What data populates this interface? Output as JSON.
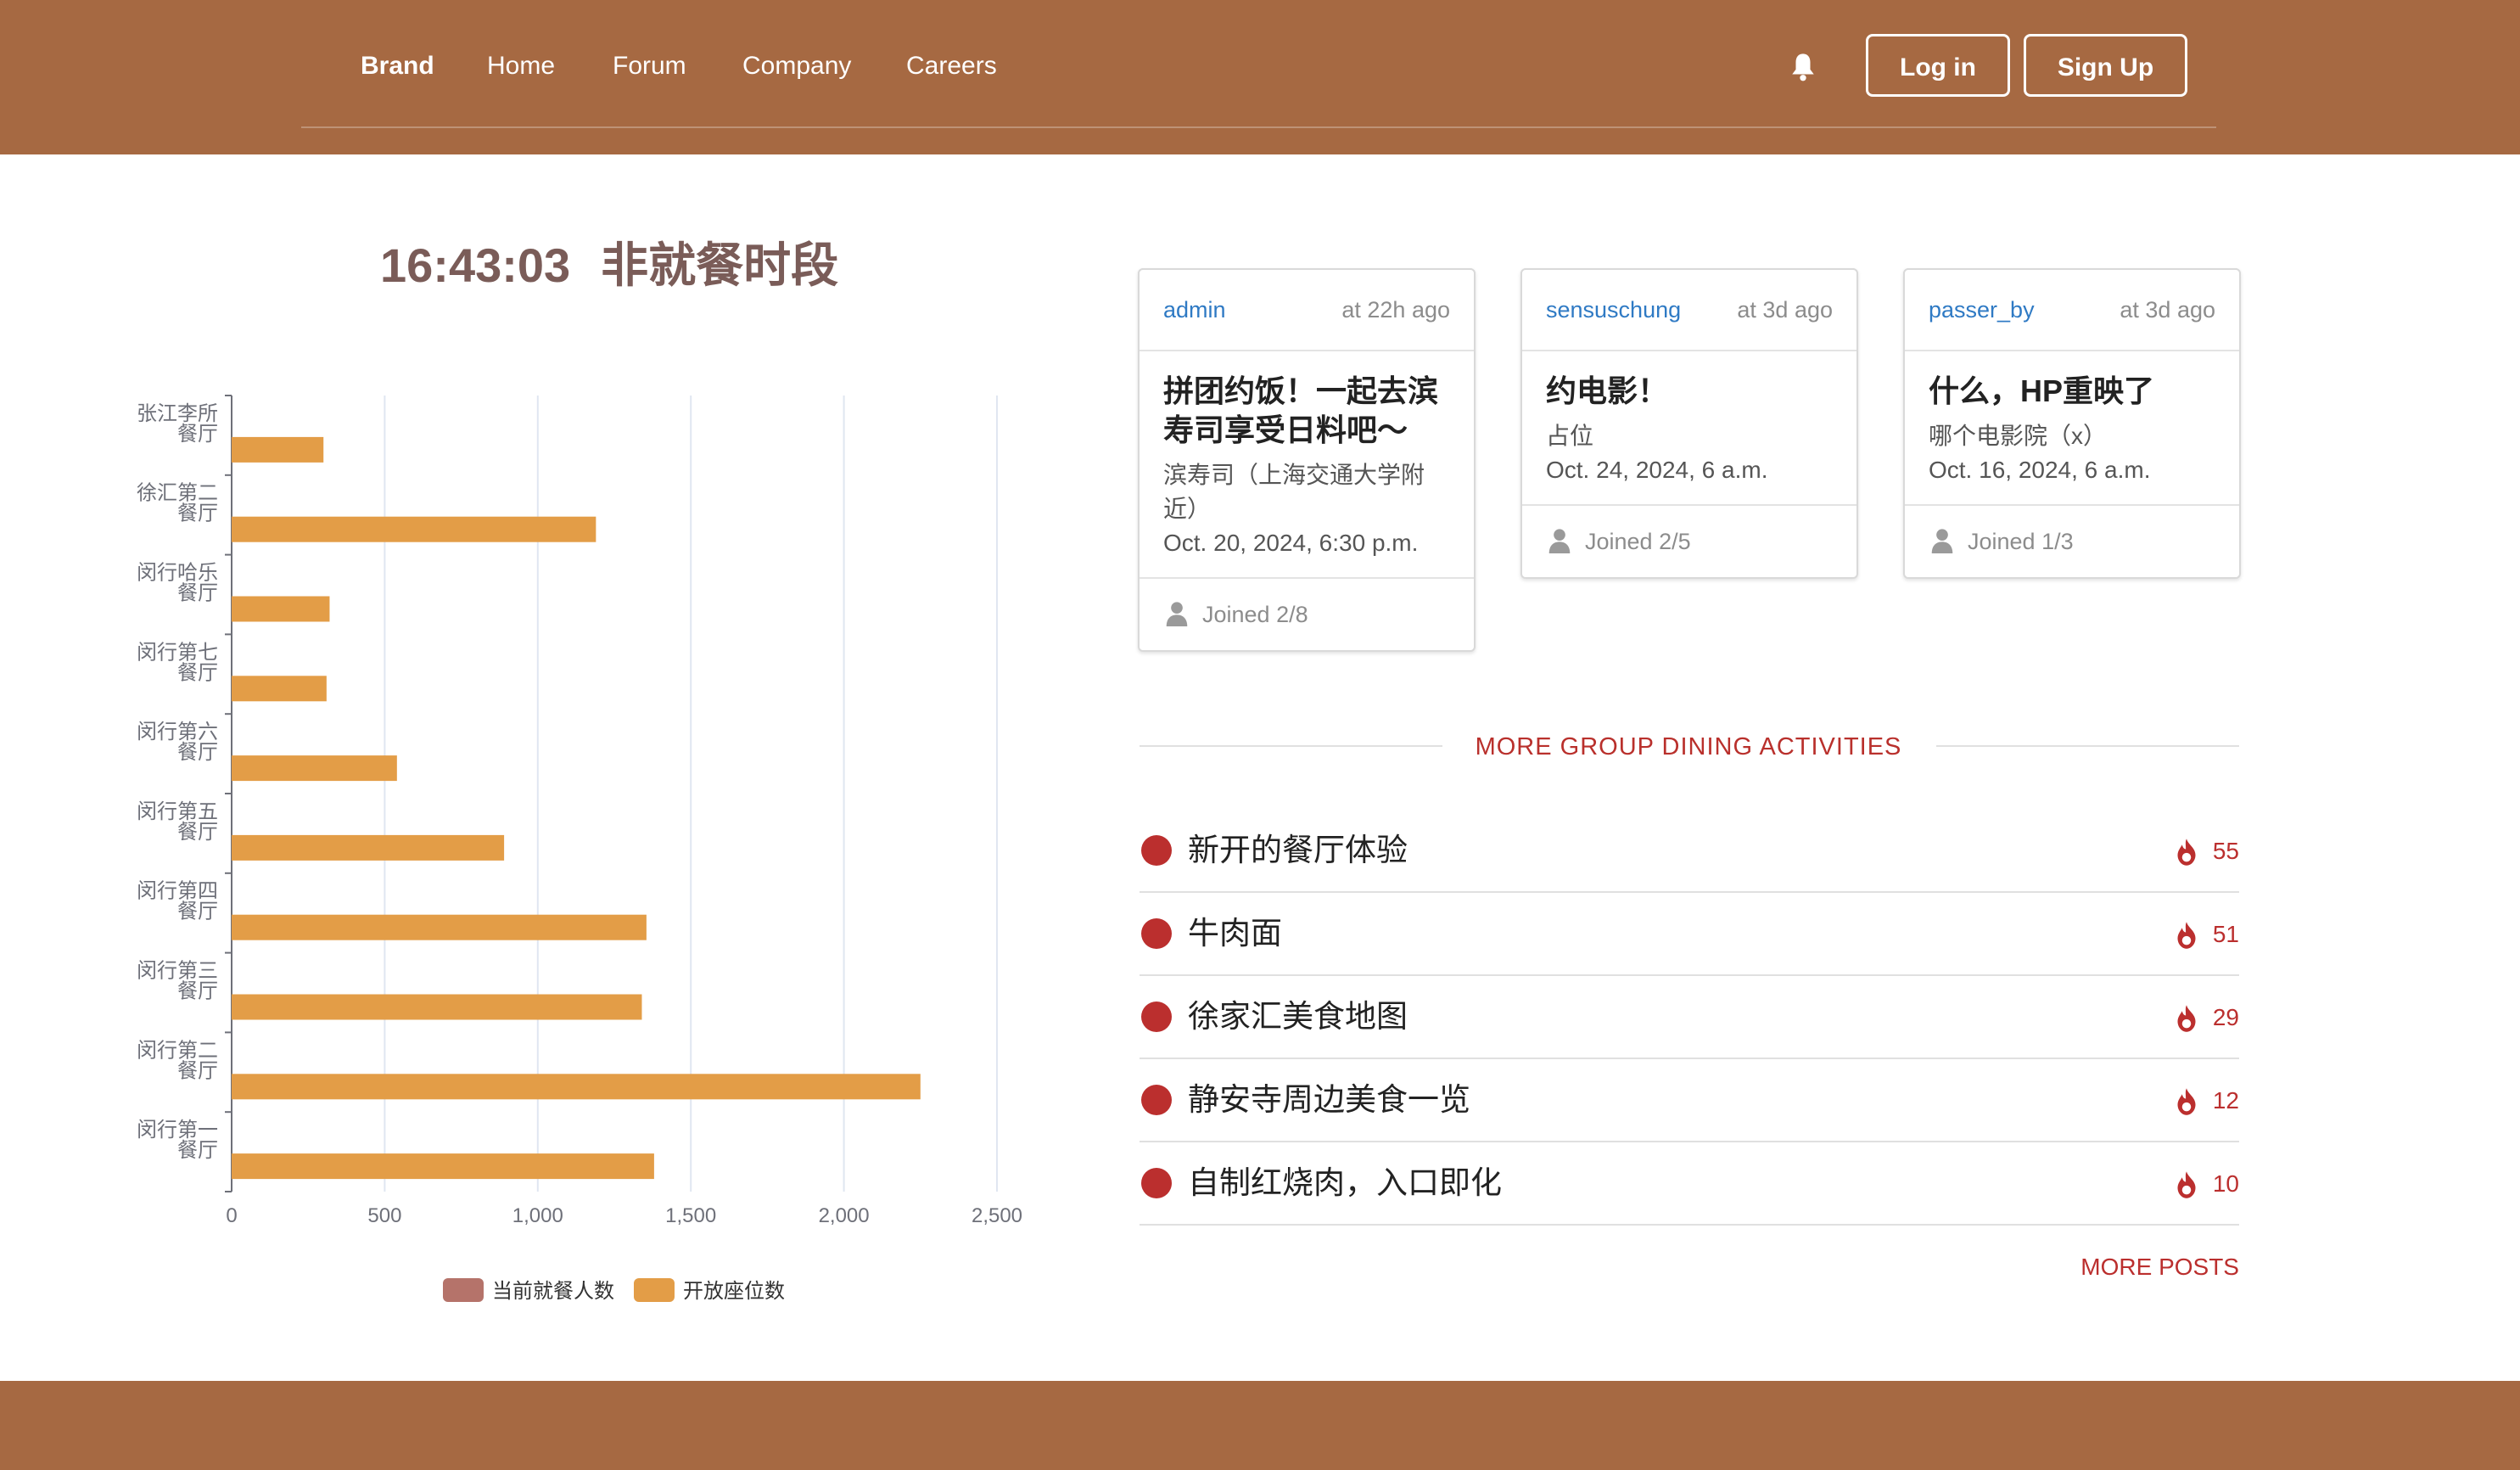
{
  "nav": {
    "brand": "Brand",
    "links": [
      "Home",
      "Forum",
      "Company",
      "Careers"
    ],
    "login_label": "Log in",
    "signup_label": "Sign Up",
    "bell_icon": "bell-icon"
  },
  "clock": {
    "time": "16:43:03",
    "status": "非就餐时段"
  },
  "chart_data": {
    "type": "bar",
    "orientation": "horizontal",
    "categories": [
      "张江李所餐厅",
      "徐汇第二餐厅",
      "闵行哈乐餐厅",
      "闵行第七餐厅",
      "闵行第六餐厅",
      "闵行第五餐厅",
      "闵行第四餐厅",
      "闵行第三餐厅",
      "闵行第二餐厅",
      "闵行第一餐厅"
    ],
    "category_label_lines": [
      [
        "张江李所",
        "餐厅"
      ],
      [
        "徐汇第二",
        "餐厅"
      ],
      [
        "闵行哈乐",
        "餐厅"
      ],
      [
        "闵行第七",
        "餐厅"
      ],
      [
        "闵行第六",
        "餐厅"
      ],
      [
        "闵行第五",
        "餐厅"
      ],
      [
        "闵行第四",
        "餐厅"
      ],
      [
        "闵行第三",
        "餐厅"
      ],
      [
        "闵行第二",
        "餐厅"
      ],
      [
        "闵行第一",
        "餐厅"
      ]
    ],
    "series": [
      {
        "name": "当前就餐人数",
        "color": "#b5736a",
        "values": [
          0,
          0,
          0,
          0,
          0,
          0,
          0,
          0,
          0,
          0
        ]
      },
      {
        "name": "开放座位数",
        "color": "#e39d47",
        "values": [
          300,
          1190,
          320,
          310,
          540,
          890,
          1355,
          1340,
          2250,
          1380
        ]
      }
    ],
    "xlim": [
      0,
      2500
    ],
    "xticks": [
      "0",
      "500",
      "1,000",
      "1,500",
      "2,000",
      "2,500"
    ],
    "xtick_values": [
      0,
      500,
      1000,
      1500,
      2000,
      2500
    ],
    "grid": true,
    "legend_position": "bottom"
  },
  "cards": [
    {
      "user": "admin",
      "time": "at 22h ago",
      "title_lines": [
        "拼团约饭！一起去滨",
        "寿司享受日料吧～"
      ],
      "lines": [
        "滨寿司（上海交通大学附",
        "近）",
        "Oct. 20, 2024, 6:30 p.m."
      ],
      "joined": "Joined 2/8"
    },
    {
      "user": "sensuschung",
      "time": "at 3d ago",
      "title_lines": [
        "约电影！"
      ],
      "lines": [
        "占位",
        "Oct. 24, 2024, 6 a.m."
      ],
      "joined": "Joined 2/5"
    },
    {
      "user": "passer_by",
      "time": "at 3d ago",
      "title_lines": [
        "什么，HP重映了"
      ],
      "lines": [
        "哪个电影院（x）",
        "Oct. 16, 2024, 6 a.m."
      ],
      "joined": "Joined 1/3"
    }
  ],
  "more": {
    "title": "MORE GROUP DINING ACTIVITIES",
    "items": [
      {
        "title": "新开的餐厅体验",
        "count": "55"
      },
      {
        "title": "牛肉面",
        "count": "51"
      },
      {
        "title": "徐家汇美食地图",
        "count": "29"
      },
      {
        "title": "静安寺周边美食一览",
        "count": "12"
      },
      {
        "title": "自制红烧肉，入口即化",
        "count": "10"
      }
    ],
    "more_posts": "MORE POSTS",
    "hot_icon": "fire-icon"
  },
  "colors": {
    "brand_brown": "#a66942",
    "accent_red": "#bb2f2e",
    "link_blue": "#2f7ac4",
    "bar_orange": "#e39d47",
    "legend_rose": "#b5736a"
  }
}
